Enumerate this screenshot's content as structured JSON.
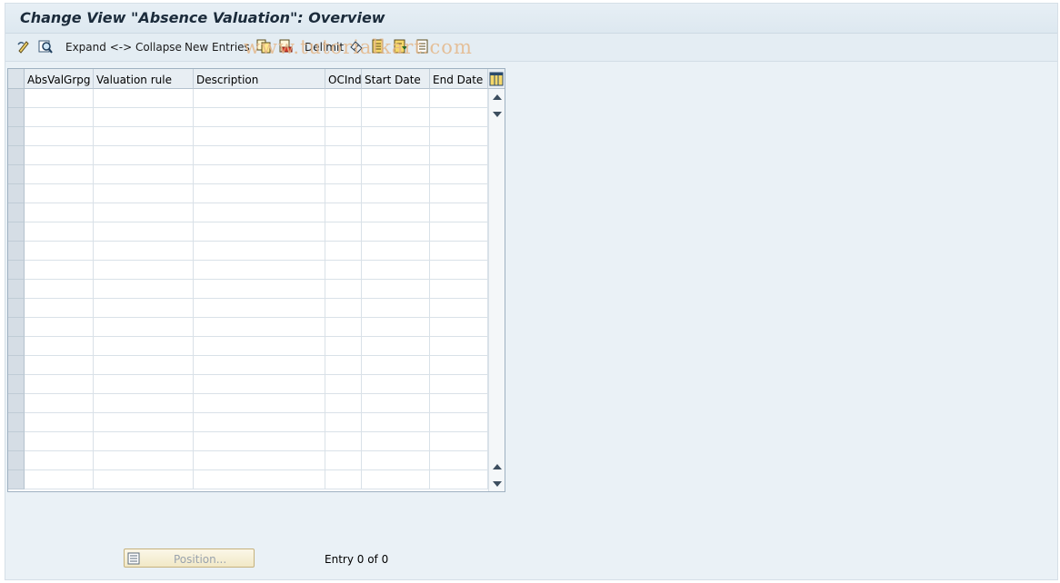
{
  "window": {
    "title": "Change View \"Absence Valuation\": Overview"
  },
  "toolbar": {
    "expand_collapse": "Expand <-> Collapse",
    "new_entries": "New Entries",
    "delimit": "Delimit",
    "watermark": "www.tutorialkart.com",
    "icons": [
      "display-change-icon",
      "details-icon",
      "copy-icon",
      "delete-icon",
      "undo-icon",
      "select-all-icon",
      "select-block-icon",
      "deselect-all-icon"
    ]
  },
  "table": {
    "columns": [
      "AbsValGrpg",
      "Valuation rule",
      "Description",
      "OCInd",
      "Start Date",
      "End Date"
    ],
    "rows": [
      [
        "",
        "",
        "",
        "",
        "",
        ""
      ],
      [
        "",
        "",
        "",
        "",
        "",
        ""
      ],
      [
        "",
        "",
        "",
        "",
        "",
        ""
      ],
      [
        "",
        "",
        "",
        "",
        "",
        ""
      ],
      [
        "",
        "",
        "",
        "",
        "",
        ""
      ],
      [
        "",
        "",
        "",
        "",
        "",
        ""
      ],
      [
        "",
        "",
        "",
        "",
        "",
        ""
      ],
      [
        "",
        "",
        "",
        "",
        "",
        ""
      ],
      [
        "",
        "",
        "",
        "",
        "",
        ""
      ],
      [
        "",
        "",
        "",
        "",
        "",
        ""
      ],
      [
        "",
        "",
        "",
        "",
        "",
        ""
      ],
      [
        "",
        "",
        "",
        "",
        "",
        ""
      ],
      [
        "",
        "",
        "",
        "",
        "",
        ""
      ],
      [
        "",
        "",
        "",
        "",
        "",
        ""
      ],
      [
        "",
        "",
        "",
        "",
        "",
        ""
      ],
      [
        "",
        "",
        "",
        "",
        "",
        ""
      ],
      [
        "",
        "",
        "",
        "",
        "",
        ""
      ],
      [
        "",
        "",
        "",
        "",
        "",
        ""
      ],
      [
        "",
        "",
        "",
        "",
        "",
        ""
      ],
      [
        "",
        "",
        "",
        "",
        "",
        ""
      ],
      [
        "",
        "",
        "",
        "",
        "",
        ""
      ]
    ]
  },
  "footer": {
    "position_button": "Position...",
    "entry_status": "Entry 0 of 0"
  },
  "colors": {
    "background": "#eaf1f6",
    "title_text": "#1b2b3b",
    "watermark": "#e5b88a",
    "button_fill": "#f1e8c6"
  }
}
